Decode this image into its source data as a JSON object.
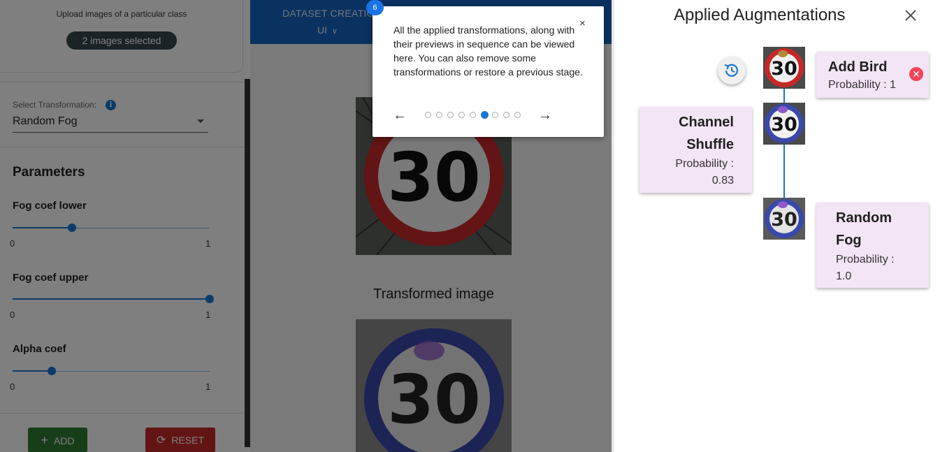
{
  "upload": {
    "instruction": "Upload images of a particular class",
    "selected_label": "2 images selected"
  },
  "transformation": {
    "select_label": "Select Transformation:",
    "info_icon": "info-icon",
    "selected_value": "Random Fog"
  },
  "parameters": {
    "title": "Parameters",
    "sliders": [
      {
        "label": "Fog coef lower",
        "value": 0.3,
        "min_label": "0",
        "max_label": "1"
      },
      {
        "label": "Fog coef upper",
        "value": 1.0,
        "min_label": "0",
        "max_label": "1"
      },
      {
        "label": "Alpha coef",
        "value": 0.2,
        "min_label": "0",
        "max_label": "1"
      }
    ]
  },
  "actions": {
    "add_label": "ADD",
    "add_icon": "plus-icon",
    "reset_label": "RESET",
    "reset_icon": "refresh-icon"
  },
  "nav": {
    "dataset_label": "DATASET CREATIO",
    "sub_label": "UI"
  },
  "preview": {
    "transformed_title": "Transformed image",
    "sign_number": "30"
  },
  "tour": {
    "step_badge": "6",
    "text": "All the applied transformations, along with their previews in sequence can be viewed here. You can also remove some transformations or restore a previous stage.",
    "close_symbol": "×",
    "prev_symbol": "←",
    "next_symbol": "→",
    "total_steps": 9,
    "current_step": 6
  },
  "applied": {
    "title": "Applied Augmentations",
    "close_icon": "close-icon",
    "history_icon": "restore-history-icon",
    "steps": [
      {
        "name": "Add Bird",
        "probability_label": "Probability : 1",
        "sign_color": "#c62828",
        "removable": true
      },
      {
        "name_line1": "Channel",
        "name_line2": "Shuffle",
        "probability_line1": "Probability :",
        "probability_line2": "0.83",
        "sign_color": "#3949ab"
      },
      {
        "name_line1": "Random",
        "name_line2": "Fog",
        "probability_line1": "Probability :",
        "probability_line2": "1.0",
        "sign_color": "#3949ab"
      }
    ],
    "thumb_number": "30"
  },
  "colors": {
    "primary": "#1976d2",
    "nav": "#1565c0",
    "add": "#2e7d32",
    "reset": "#c62828",
    "card": "#f3e5f5",
    "remove": "#f44359"
  }
}
